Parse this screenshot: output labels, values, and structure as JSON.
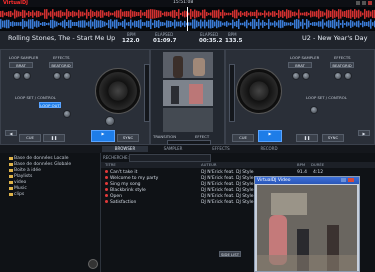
{
  "app": {
    "name": "VirtualDJ",
    "center_time": "15:51:08"
  },
  "deck_left": {
    "title": "Rolling Stones, The - Start Me Up",
    "bpm_label": "BPM",
    "bpm": "122.0",
    "elapsed_label": "ELAPSED",
    "elapsed": "01:09.7",
    "loop_sampler": "LOOP SAMPLER",
    "effects": "EFFECTS",
    "sampler_select": "BRAT",
    "effect_select": "BEATGRID",
    "loop_out": "LOOP OUT",
    "loop_set_control": "LOOP SET / CONTROL",
    "cue": "CUE",
    "play": "PLAY",
    "pause": "PAUSE",
    "sync": "SYNC",
    "pitch": "PITCH",
    "keylock": "KEYLOCK"
  },
  "deck_right": {
    "title": "U2 - New Year's Day",
    "bpm_label": "BPM",
    "bpm": "133.5",
    "elapsed_label": "ELAPSED",
    "elapsed": "00:35.2",
    "loop_sampler": "LOOP SAMPLER",
    "effects": "EFFECTS",
    "sampler_select": "BRAT",
    "effect_select": "BEATGRID",
    "loop_set_control": "LOOP SET / CONTROL",
    "cue": "CUE",
    "play": "PLAY",
    "pause": "PAUSE",
    "sync": "SYNC",
    "pitch": "PITCH",
    "keylock": "KEYLOCK"
  },
  "mixer": {
    "transition": "TRANSITION",
    "effect": "EFFECT",
    "crossfader": "CROSSFADER"
  },
  "tabs": [
    "BROWSER",
    "SAMPLER",
    "EFFECTS",
    "RECORD"
  ],
  "tree": [
    "Base de données Locale",
    "Base de données Globale",
    "Boite à idée",
    "Playlists",
    "video",
    "Music",
    "clips"
  ],
  "search_label": "RECHERCHE:",
  "columns": {
    "title": "TITRE",
    "author": "AUTEUR",
    "bpm": "BPM",
    "length": "DURÉE"
  },
  "files": [
    {
      "title": "Can't take it",
      "author": "DJ N'Erick feat. DJ Style",
      "bpm": "91.4",
      "length": "4:12"
    },
    {
      "title": "Welcome to my party",
      "author": "DJ N'Erick feat. DJ Style",
      "bpm": "",
      "length": ""
    },
    {
      "title": "Sing my song",
      "author": "DJ N'Erick feat. DJ Style",
      "bpm": "",
      "length": ""
    },
    {
      "title": "Blackbrink style",
      "author": "DJ N'Erick feat. DJ Style",
      "bpm": "",
      "length": ""
    },
    {
      "title": "Open",
      "author": "DJ N'Erick feat. DJ Style",
      "bpm": "",
      "length": ""
    },
    {
      "title": "Satisfaction",
      "author": "DJ N'Erick feat. DJ Style",
      "bpm": "",
      "length": ""
    }
  ],
  "sideline": "SIDE LIST",
  "video_window": {
    "title": "VirtualDJ Video"
  }
}
